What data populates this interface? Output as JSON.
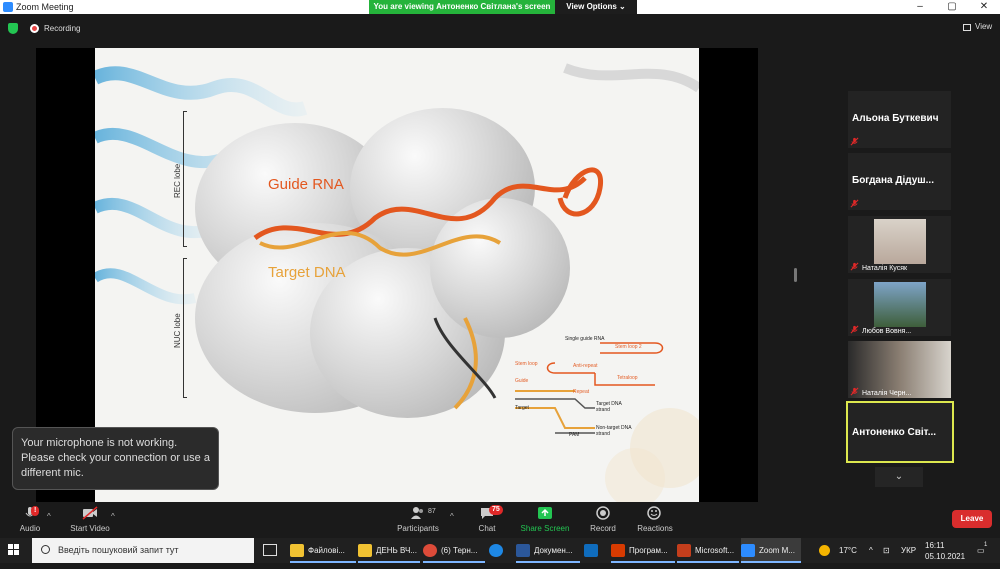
{
  "window": {
    "title": "Zoom Meeting",
    "share_banner": "You are viewing Антоненко Світлана's screen",
    "view_options": "View Options",
    "min_icon": "minimize-icon",
    "max_icon": "maximize-icon",
    "close_icon": "close-icon"
  },
  "status": {
    "recording": "Recording",
    "view": "View"
  },
  "slide": {
    "guide_rna": "Guide RNA",
    "target_dna": "Target DNA",
    "rec_lobe": "REC lobe",
    "nuc_lobe": "NUC lobe",
    "diagram": {
      "single_guide_rna": "Single guide RNA",
      "stem_loop_2": "Stem loop 2",
      "stem_loop": "Stem loop",
      "anti_repeat": "Anti-repeat",
      "tetraloop": "Tetraloop",
      "guide": "Guide",
      "repeat": "Repeat",
      "target": "Target",
      "target_dna_strand": "Target DNA strand",
      "non_target_dna_strand": "Non-target DNA strand",
      "pam": "PAM"
    }
  },
  "tooltip": {
    "text": "Your microphone is not working. Please check your connection or use a different mic."
  },
  "participants": [
    {
      "name": "Альона Буткевич",
      "type": "name"
    },
    {
      "name": "Богдана Дідуш...",
      "type": "name"
    },
    {
      "name": "Наталія Кусяк",
      "type": "video"
    },
    {
      "name": "Любов Вовня...",
      "type": "video"
    },
    {
      "name": "Наталія Черн...",
      "type": "video"
    },
    {
      "name": "Антоненко Світ...",
      "type": "active"
    }
  ],
  "toolbar": {
    "audio": "Audio",
    "audio_badge": "!",
    "start_video": "Start Video",
    "participants": "Participants",
    "participants_count": "87",
    "chat": "Chat",
    "chat_badge": "75",
    "share_screen": "Share Screen",
    "record": "Record",
    "reactions": "Reactions",
    "leave": "Leave"
  },
  "taskbar": {
    "search_placeholder": "Введіть пошуковий запит тут",
    "items": [
      {
        "label": "Файлові...",
        "color": "#f1c232"
      },
      {
        "label": "ДЕНЬ ВЧ...",
        "color": "#f1c232"
      },
      {
        "label": "(6) Терн...",
        "color": "#dd4b39"
      },
      {
        "label": "",
        "color": "#1e88e5"
      },
      {
        "label": "Докумен...",
        "color": "#2b579a"
      },
      {
        "label": "",
        "color": "#0f6cbd"
      },
      {
        "label": "Програм...",
        "color": "#d83b01"
      },
      {
        "label": "Microsoft...",
        "color": "#c43e1c"
      },
      {
        "label": "Zoom M...",
        "color": "#2d8cff"
      }
    ],
    "temperature": "17°C",
    "language": "УКР",
    "time": "16:11",
    "date": "05.10.2021",
    "notification_count": "1"
  },
  "colors": {
    "accent_green": "#23c552",
    "zoom_blue": "#2d8cff",
    "leave_red": "#d92d2d",
    "active_border": "#dde84e"
  }
}
